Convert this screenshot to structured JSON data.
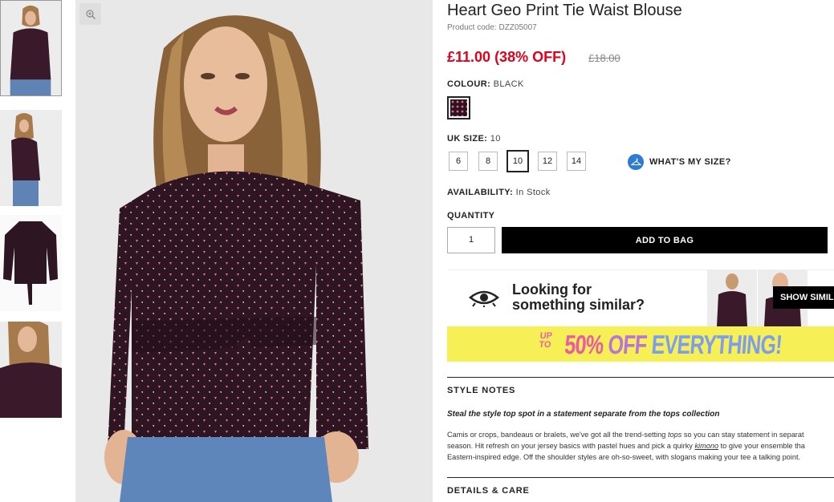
{
  "product": {
    "title": "Heart Geo Print Tie Waist Blouse",
    "code_label": "Product code:",
    "code": "DZZ05007",
    "price": "£11.00 (38% OFF)",
    "was_price": "£18.00"
  },
  "colour": {
    "label": "COLOUR:",
    "value": "BLACK"
  },
  "size": {
    "label": "UK SIZE:",
    "value": "10",
    "options": [
      "6",
      "8",
      "10",
      "12",
      "14"
    ],
    "selected": "10",
    "whats_my_size": "WHAT'S MY SIZE?"
  },
  "availability": {
    "label": "AVAILABILITY:",
    "value": "In Stock"
  },
  "quantity": {
    "label": "QUANTITY",
    "value": "1"
  },
  "add_to_bag": "ADD TO BAG",
  "similar": {
    "line1": "Looking for",
    "line2": "something similar?",
    "button": "SHOW SIMIL"
  },
  "banner": {
    "up": "UP",
    "to": "TO",
    "word1": "50%",
    "word2": "OFF",
    "word3": "EVERYTHING!"
  },
  "style_notes": {
    "heading": "STYLE NOTES",
    "lead": "Steal the style top spot in a statement separate from the tops collection",
    "l1a": "Camis or crops, bandeaus or bralets, we've got all the trend-setting ",
    "l1b": "tops",
    "l1c": " so you can stay statement in separat",
    "l2a": "season. Hit refresh on your jersey basics with pastel hues and pick a quirky ",
    "l2b": "kimono",
    "l2c": " to give your ensemble tha",
    "l3": "Eastern-inspired edge. Off the shoulder styles are oh-so-sweet, with slogans making your tee a talking point."
  },
  "details_care": {
    "heading": "DETAILS & CARE"
  },
  "colors": {
    "sale_red": "#e2001a",
    "banner_yellow": "#f6ef55",
    "accent_blue": "#2e7ccf"
  }
}
